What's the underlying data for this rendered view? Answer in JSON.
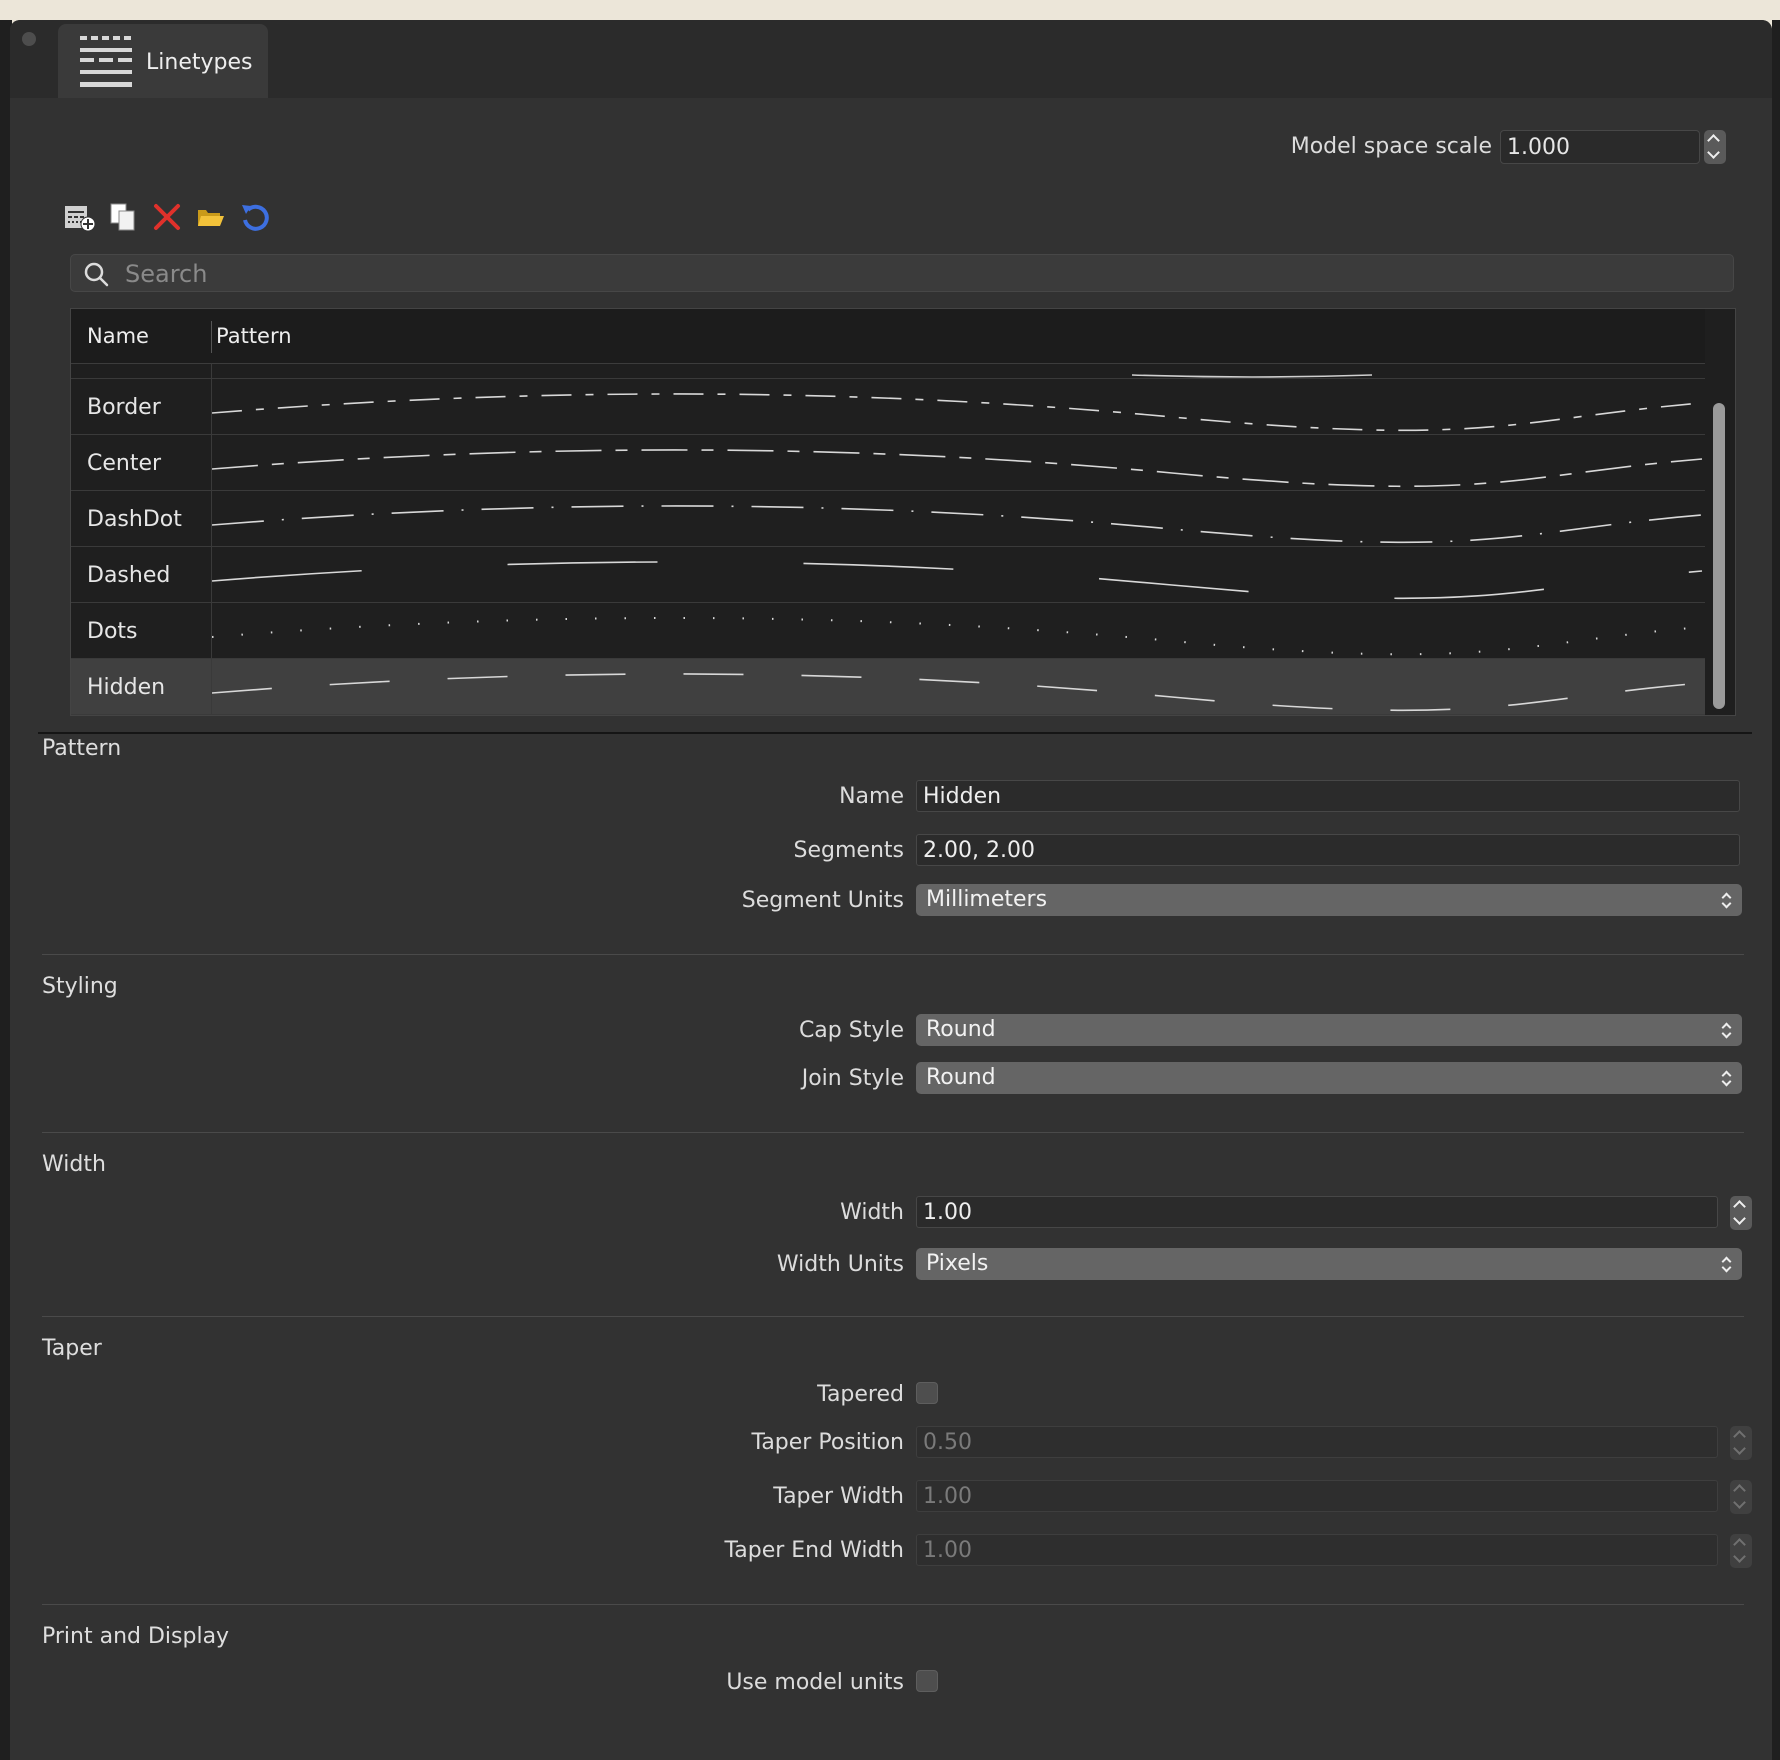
{
  "tab": {
    "label": "Linetypes",
    "icon": "linetypes-icon"
  },
  "scale": {
    "label": "Model space scale",
    "value": "1.000"
  },
  "toolbar": {
    "icons": [
      "new-linetype-icon",
      "duplicate-icon",
      "delete-icon",
      "open-folder-icon",
      "reload-icon"
    ]
  },
  "search": {
    "placeholder": "Search"
  },
  "table": {
    "headers": {
      "name": "Name",
      "pattern": "Pattern"
    },
    "rows": [
      {
        "name": "Border",
        "pattern": "dash-dash-short"
      },
      {
        "name": "Center",
        "pattern": "long-short"
      },
      {
        "name": "DashDot",
        "pattern": "dash-dot"
      },
      {
        "name": "Dashed",
        "pattern": "long-dash"
      },
      {
        "name": "Dots",
        "pattern": "dots"
      },
      {
        "name": "Hidden",
        "pattern": "short-dash",
        "selected": true
      }
    ]
  },
  "pattern": {
    "title": "Pattern",
    "name_label": "Name",
    "name_value": "Hidden",
    "segments_label": "Segments",
    "segments_value": "2.00, 2.00",
    "units_label": "Segment Units",
    "units_value": "Millimeters"
  },
  "styling": {
    "title": "Styling",
    "cap_label": "Cap Style",
    "cap_value": "Round",
    "join_label": "Join Style",
    "join_value": "Round"
  },
  "width": {
    "title": "Width",
    "width_label": "Width",
    "width_value": "1.00",
    "units_label": "Width Units",
    "units_value": "Pixels"
  },
  "taper": {
    "title": "Taper",
    "tapered_label": "Tapered",
    "tapered": false,
    "position_label": "Taper Position",
    "position_value": "0.50",
    "width_label": "Taper Width",
    "width_value": "1.00",
    "end_label": "Taper End Width",
    "end_value": "1.00"
  },
  "print": {
    "title": "Print and Display",
    "model_units_label": "Use model units",
    "model_units": false
  }
}
